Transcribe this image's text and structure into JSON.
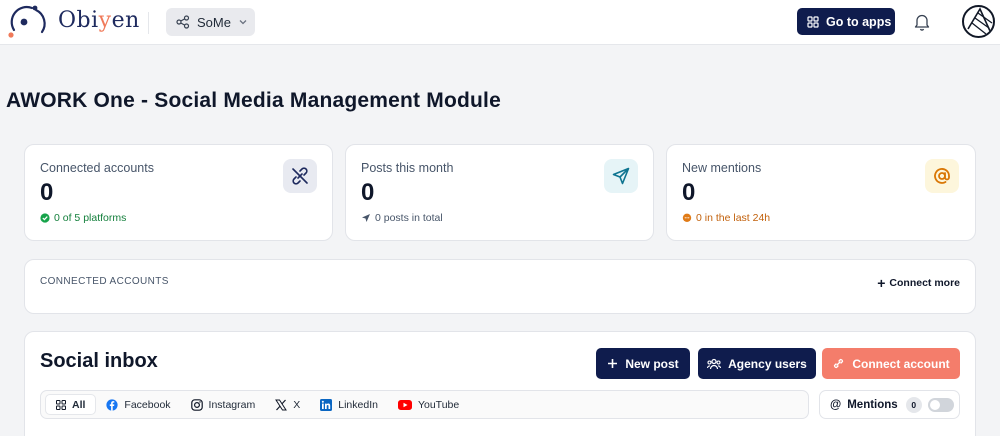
{
  "header": {
    "brand": {
      "prefix": "Obi",
      "highlight": "y",
      "suffix": "en"
    },
    "module_selector": {
      "label": "SoMe",
      "icon": "share-icon"
    },
    "go_to_apps": "Go to apps",
    "notification_icon": "bell-icon",
    "avatar_icon": "user-avatar"
  },
  "page": {
    "title": "AWORK One - Social Media Management Module"
  },
  "stats": [
    {
      "label": "Connected accounts",
      "value": "0",
      "sub": "0 of 5 platforms",
      "icon": "unlink-icon",
      "sub_icon": "check-circle-icon",
      "sub_color": "#15803d"
    },
    {
      "label": "Posts this month",
      "value": "0",
      "sub": "0 posts in total",
      "icon": "send-icon",
      "sub_icon": "send-icon",
      "sub_color": "#475569"
    },
    {
      "label": "New mentions",
      "value": "0",
      "sub": "0 in the last 24h",
      "icon": "at-icon",
      "sub_icon": "chat-bubble-icon",
      "sub_color": "#c2610c"
    }
  ],
  "connected_accounts": {
    "title": "CONNECTED ACCOUNTS",
    "connect_more": "Connect more"
  },
  "inbox": {
    "title": "Social inbox",
    "buttons": {
      "new_post": "New post",
      "agency_users": "Agency users",
      "connect_account": "Connect account"
    },
    "filters": [
      {
        "label": "All",
        "icon": "grid-icon",
        "active": true
      },
      {
        "label": "Facebook",
        "icon": "facebook-icon"
      },
      {
        "label": "Instagram",
        "icon": "instagram-icon"
      },
      {
        "label": "X",
        "icon": "x-icon"
      },
      {
        "label": "LinkedIn",
        "icon": "linkedin-icon"
      },
      {
        "label": "YouTube",
        "icon": "youtube-icon"
      }
    ],
    "mentions": {
      "label": "Mentions",
      "count": "0",
      "toggle_on": false
    }
  },
  "colors": {
    "navy": "#0f1c4d",
    "coral": "#f47d6b",
    "accent_orange": "#f07a5a"
  }
}
